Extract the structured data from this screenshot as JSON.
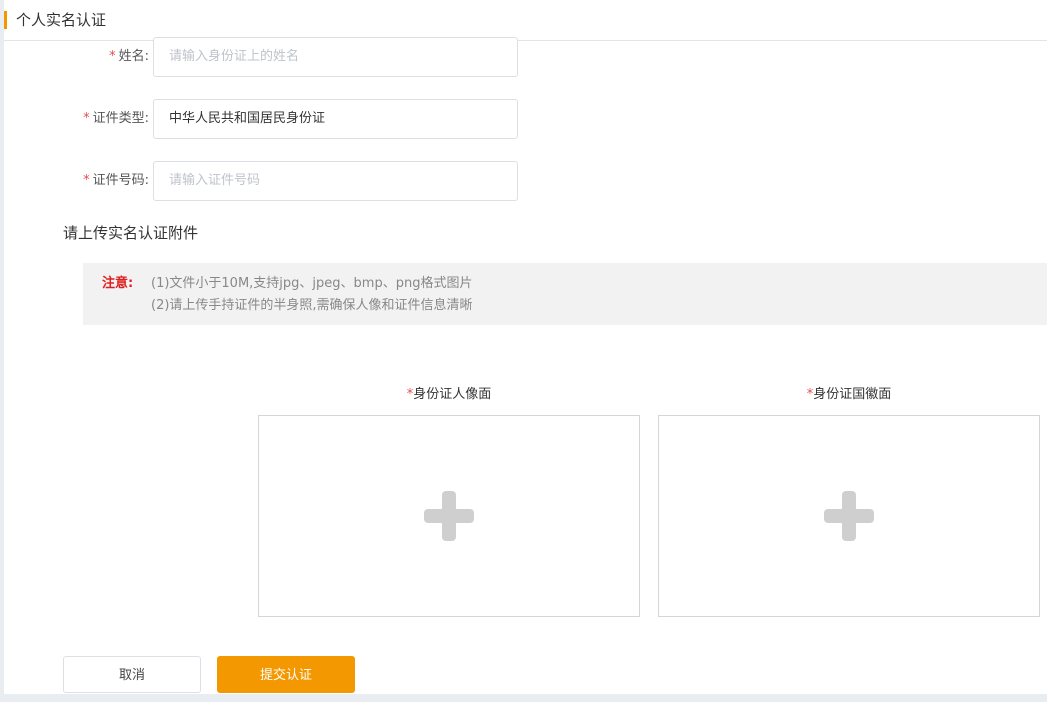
{
  "header": {
    "title": "个人实名认证"
  },
  "form": {
    "name": {
      "required_mark": "*",
      "label": "姓名:",
      "placeholder": "请输入身份证上的姓名",
      "value": ""
    },
    "id_type": {
      "required_mark": "*",
      "label": "证件类型:",
      "value": "中华人民共和国居民身份证"
    },
    "id_number": {
      "required_mark": "*",
      "label": "证件号码:",
      "placeholder": "请输入证件号码",
      "value": ""
    }
  },
  "attachments": {
    "title": "请上传实名认证附件",
    "notice": {
      "tag": "注意:",
      "lines": [
        "(1)文件小于10M,支持jpg、jpeg、bmp、png格式图片",
        "(2)请上传手持证件的半身照,需确保人像和证件信息清晰"
      ]
    },
    "uploads": [
      {
        "required_mark": "*",
        "label": "身份证人像面",
        "icon": "plus-icon"
      },
      {
        "required_mark": "*",
        "label": "身份证国徽面",
        "icon": "plus-icon"
      }
    ]
  },
  "actions": {
    "cancel_label": "取消",
    "submit_label": "提交认证"
  },
  "colors": {
    "accent": "#f39800",
    "required": "#e84b4b",
    "notice_tag": "#e02020"
  }
}
